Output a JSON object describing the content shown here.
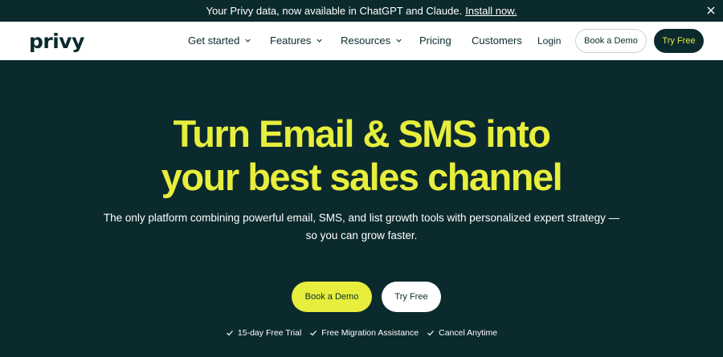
{
  "announcement": {
    "text": "Your Privy data, now available in ChatGPT and Claude.",
    "link": "Install now."
  },
  "nav": {
    "logo": "privy",
    "items": [
      {
        "label": "Get started",
        "dropdown": true
      },
      {
        "label": "Features",
        "dropdown": true
      },
      {
        "label": "Resources",
        "dropdown": true
      },
      {
        "label": "Pricing",
        "dropdown": false
      },
      {
        "label": "Customers",
        "dropdown": false
      }
    ],
    "login": "Login",
    "book_demo": "Book a Demo",
    "try_free": "Try Free"
  },
  "hero": {
    "headline_line1": "Turn Email & SMS into",
    "headline_line2": "your best sales channel",
    "subtitle_line1": "The only platform combining powerful email, SMS, and list growth tools with personalized expert strategy —",
    "subtitle_line2": "so you can grow faster.",
    "book_demo": "Book a Demo",
    "try_free": "Try Free",
    "features": [
      "15-day Free Trial",
      "Free Migration Assistance",
      "Cancel Anytime"
    ]
  },
  "colors": {
    "background": "#0b2a2e",
    "accent": "#e7ee3c",
    "white": "#ffffff"
  }
}
